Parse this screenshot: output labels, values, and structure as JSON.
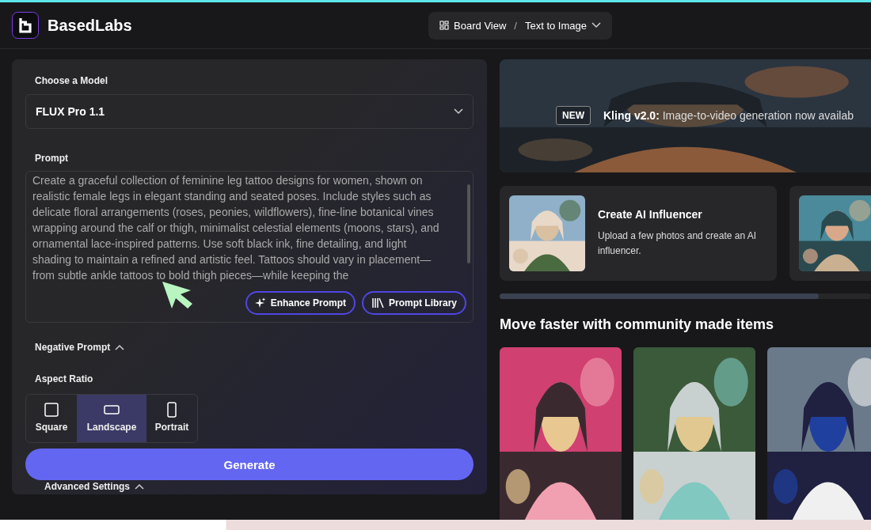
{
  "header": {
    "brand": "BasedLabs",
    "breadcrumb": {
      "view": "Board View",
      "separator": "/",
      "page": "Text to Image"
    }
  },
  "form": {
    "model_label": "Choose a Model",
    "model": "FLUX Pro 1.1",
    "prompt_label": "Prompt",
    "prompt": "Create a graceful collection of feminine leg tattoo designs for women, shown on realistic female legs in elegant standing and seated poses. Include styles such as delicate floral arrangements (roses, peonies, wildflowers), fine-line botanical vines wrapping around the calf or thigh, minimalist celestial elements (moons, stars), and ornamental lace-inspired patterns. Use soft black ink, fine detailing, and light shading to maintain a refined and artistic feel. Tattoos should vary in placement—from subtle ankle tattoos to bold thigh pieces—while keeping the",
    "prompt_buttons": [
      {
        "kind": "enhance",
        "label": "Enhance Prompt"
      },
      {
        "kind": "library",
        "label": "Prompt Library"
      }
    ],
    "negative_prompt": "Negative Prompt",
    "aspect_label": "Aspect Ratio",
    "aspect_ratios": [
      {
        "kind": "square",
        "label": "Square",
        "selected": false
      },
      {
        "kind": "landscape",
        "label": "Landscape",
        "selected": true
      },
      {
        "kind": "portrait",
        "label": "Portrait",
        "selected": false
      }
    ],
    "generate": "Generate",
    "advanced": "Advanced Settings"
  },
  "banner": {
    "badge": "NEW",
    "text": "**Kling v2.0:** Image-to-video generation now availab"
  },
  "cards": [
    {
      "title": "Create AI Influencer",
      "description": "Upload a few photos and create an AI influencer."
    },
    {
      "kind": "picture"
    }
  ],
  "community": {
    "heading": "Move faster with community made items",
    "items": [
      {
        "kind": "picture"
      },
      {
        "kind": "picture"
      },
      {
        "kind": "picture"
      }
    ]
  }
}
